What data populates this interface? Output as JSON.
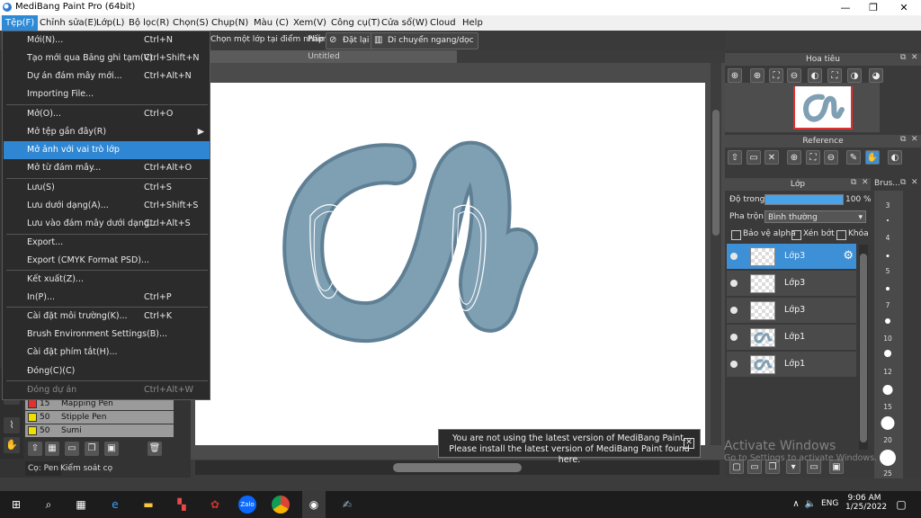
{
  "window": {
    "title": "MediBang Paint Pro (64bit)",
    "minimize": "—",
    "maximize": "❐",
    "close": "✕"
  },
  "menubar": [
    "Tệp(F)",
    "Chỉnh sửa(E)",
    "Lớp(L)",
    "Bộ lọc(R)",
    "Chọn(S)",
    "Chụp(N)",
    "Màu (C)",
    "Xem(V)",
    "Công cụ(T)",
    "Cửa sổ(W)",
    "Cloud",
    "Help"
  ],
  "toolbar": {
    "select_hint": "Chọn một lớp tại điểm nhấp",
    "key_label": "Phím",
    "reset_label": "Đặt lại",
    "move_label": "Di chuyển ngang/dọc"
  },
  "document": {
    "tab_title": "Untitled"
  },
  "file_menu": {
    "items": [
      {
        "label": "Mới(N)...",
        "shortcut": "Ctrl+N"
      },
      {
        "label": "Tạo mới qua Bảng ghi tạm(V)",
        "shortcut": "Ctrl+Shift+N"
      },
      {
        "label": "Dự án đám mây mới...",
        "shortcut": "Ctrl+Alt+N"
      },
      {
        "label": "Importing File...",
        "shortcut": ""
      },
      {
        "label": "Mở(O)...",
        "shortcut": "Ctrl+O"
      },
      {
        "label": "Mở tệp gần đây(R)",
        "shortcut": ""
      },
      {
        "label": "Mở ảnh với vai trò lớp",
        "shortcut": ""
      },
      {
        "label": "Mở từ đám mây...",
        "shortcut": "Ctrl+Alt+O"
      },
      {
        "label": "Lưu(S)",
        "shortcut": "Ctrl+S"
      },
      {
        "label": "Lưu dưới dạng(A)...",
        "shortcut": "Ctrl+Shift+S"
      },
      {
        "label": "Lưu vào đám mây dưới dạng...",
        "shortcut": "Ctrl+Alt+S"
      },
      {
        "label": "Export...",
        "shortcut": ""
      },
      {
        "label": "Export (CMYK Format PSD)...",
        "shortcut": ""
      },
      {
        "label": "Kết xuất(Z)...",
        "shortcut": ""
      },
      {
        "label": "In(P)...",
        "shortcut": "Ctrl+P"
      },
      {
        "label": "Cài đặt môi trường(K)...",
        "shortcut": "Ctrl+K"
      },
      {
        "label": "Brush Environment Settings(B)...",
        "shortcut": ""
      },
      {
        "label": "Cài đặt phím tắt(H)...",
        "shortcut": ""
      },
      {
        "label": "Đóng(C)(C)",
        "shortcut": ""
      },
      {
        "label": "Đóng dự án",
        "shortcut": "Ctrl+Alt+W"
      }
    ],
    "submenu_arrow": "▶"
  },
  "brushes": [
    {
      "size": "15",
      "name": "Mapping Pen",
      "color": "#e03030"
    },
    {
      "size": "50",
      "name": "Stipple Pen",
      "color": "#f0e000"
    },
    {
      "size": "50",
      "name": "Sumi",
      "color": "#f0e000"
    }
  ],
  "left_tabs": {
    "pen": "Cọ: Pen",
    "shading": "Kiểm soát cọ"
  },
  "navigator": {
    "title": "Hoa tiêu"
  },
  "reference": {
    "title": "Reference"
  },
  "layers": {
    "title": "Lớp",
    "opacity_label": "Độ trong",
    "opacity_value": 100,
    "opacity_text": "100 %",
    "blend_label": "Pha trộn",
    "blend_value": "Bình thường",
    "protect_alpha": "Bảo vệ alpha",
    "clipping": "Xén bớt",
    "lock": "Khóa",
    "rows": [
      {
        "name": "Lớp3",
        "selected": true,
        "type": "empty"
      },
      {
        "name": "Lớp3",
        "selected": false,
        "type": "empty"
      },
      {
        "name": "Lớp3",
        "selected": false,
        "type": "empty"
      },
      {
        "name": "Lớp1",
        "selected": false,
        "type": "art"
      },
      {
        "name": "Lớp1",
        "selected": false,
        "type": "art"
      }
    ]
  },
  "brush_sizes": {
    "title": "Brus...",
    "values": [
      "3",
      "4",
      "5",
      "7",
      "10",
      "12",
      "15",
      "20",
      "25"
    ]
  },
  "notification": {
    "line1": "You are not using the latest version of MediBang Paint.",
    "line2": "Please install the latest version of MediBang Paint found here.",
    "close": "✕"
  },
  "watermark": {
    "title": "Activate Windows",
    "subtitle": "Go to Settings to activate Windows."
  },
  "taskbar": {
    "language": "ENG",
    "time": "9:06 AM",
    "date": "1/25/2022",
    "zalo": "Zalo"
  },
  "colors": {
    "accent": "#2f86d2",
    "letter_fill": "#7f9fb3",
    "letter_shadow": "#5f7f94"
  }
}
